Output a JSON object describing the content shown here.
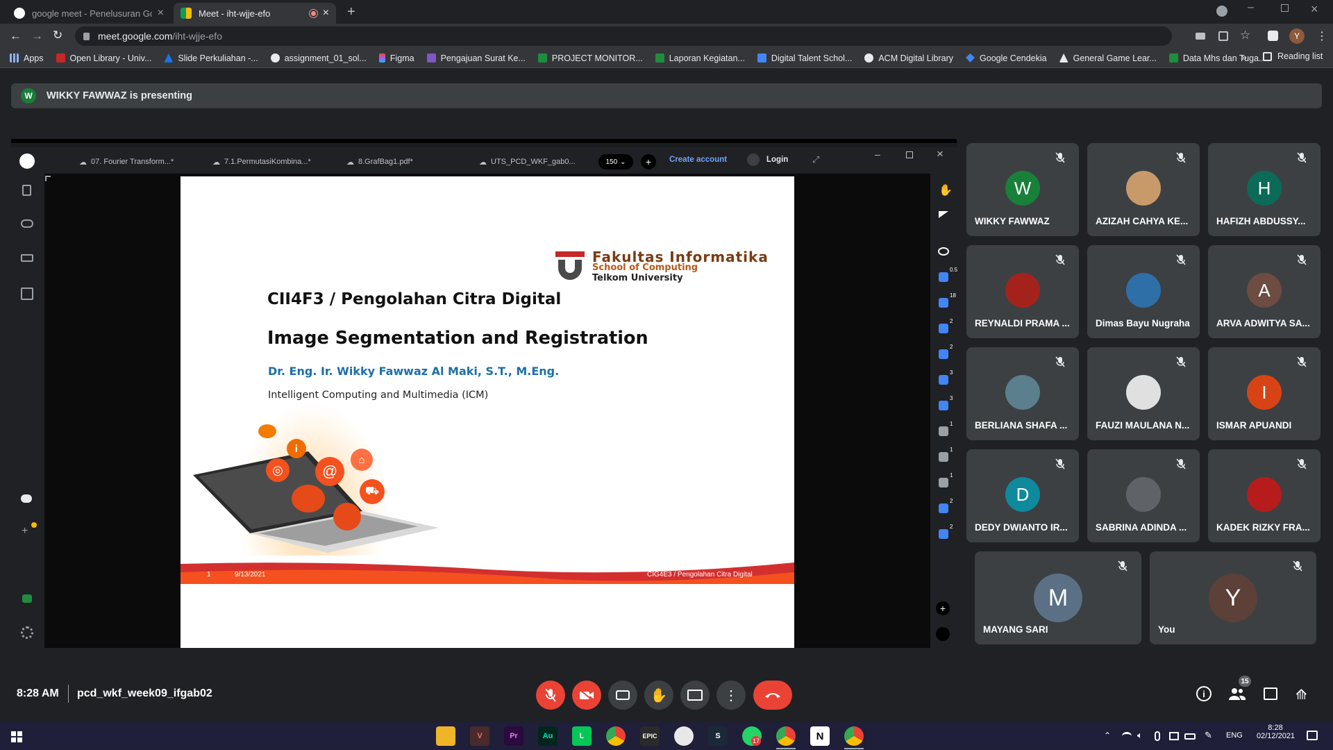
{
  "browser": {
    "tabs": [
      {
        "label": "google meet - Penelusuran Goog",
        "active": false
      },
      {
        "label": "Meet - iht-wjje-efo",
        "active": true
      }
    ],
    "url_host": "meet.google.com",
    "url_path": "/iht-wjje-efo",
    "profile_initial": "Y",
    "bookmarks": [
      "Apps",
      "Open Library - Univ...",
      "Slide Perkuliahan -...",
      "assignment_01_sol...",
      "Figma",
      "Pengajuan Surat Ke...",
      "PROJECT MONITOR...",
      "Laporan Kegiatan...",
      "Digital Talent Schol...",
      "ACM Digital Library",
      "Google Cendekia",
      "General Game Lear...",
      "Data Mhs dan Tuga..."
    ],
    "reading_list": "Reading list"
  },
  "meet": {
    "banner_initial": "W",
    "banner": "WIKKY FAWWAZ is presenting",
    "time": "8:28 AM",
    "meeting_code": "pcd_wkf_week09_ifgab02",
    "people_count": "15"
  },
  "pdf_viewer": {
    "tabs": [
      "07. Fourier Transform...*",
      "7.1.PermutasiKombina...*",
      "8.GrafBag1.pdf*",
      "UTS_PCD_WKF_gab0..."
    ],
    "zoom": "150",
    "create_account": "Create account",
    "login": "Login",
    "rail_badges": [
      "0.5",
      "18",
      "2",
      "2",
      "3",
      "3",
      "1",
      "1",
      "1",
      "2",
      "2"
    ]
  },
  "slide": {
    "logo_line1": "Fakultas Informatika",
    "logo_line2": "School of Computing",
    "logo_line3": "Telkom University",
    "course": "CII4F3 / Pengolahan Citra Digital",
    "title": "Image Segmentation and Registration",
    "author": "Dr. Eng.  Ir.  Wikky Fawwaz Al Maki, S.T., M.Eng.",
    "group": "Intelligent Computing and Multimedia (ICM)",
    "footer_page": "1",
    "footer_date": "9/13/2021",
    "footer_course": "CIG4E3 / Pengolahan Citra Digital"
  },
  "participants": [
    {
      "name": "WIKKY FAWWAZ",
      "initial": "W",
      "color": "#188038"
    },
    {
      "name": "AZIZAH CAHYA KE...",
      "initial": "",
      "color": "#c89a6a"
    },
    {
      "name": "HAFIZH ABDUSSY...",
      "initial": "H",
      "color": "#0b6b58"
    },
    {
      "name": "REYNALDI PRAMA ...",
      "initial": "",
      "color": "#a3231c"
    },
    {
      "name": "Dimas Bayu Nugraha",
      "initial": "",
      "color": "#2f6fa8"
    },
    {
      "name": "ARVA ADWITYA SA...",
      "initial": "A",
      "color": "#6d4c41"
    },
    {
      "name": "BERLIANA SHAFA ...",
      "initial": "",
      "color": "#5b7f8c"
    },
    {
      "name": "FAUZI MAULANA N...",
      "initial": "",
      "color": "#e0e0e0"
    },
    {
      "name": "ISMAR APUANDI",
      "initial": "I",
      "color": "#d84315"
    },
    {
      "name": "DEDY DWIANTO IR...",
      "initial": "D",
      "color": "#0f8a9d"
    },
    {
      "name": "SABRINA ADINDA ...",
      "initial": "",
      "color": "#5f6368"
    },
    {
      "name": "KADEK RIZKY FRA...",
      "initial": "",
      "color": "#b71c1c"
    },
    {
      "name": "MAYANG SARI",
      "initial": "M",
      "color": "#5b7085"
    },
    {
      "name": "You",
      "initial": "Y",
      "color": "#5d4037"
    }
  ],
  "taskbar": {
    "lang": "ENG",
    "time": "8:28",
    "date": "02/12/2021",
    "whatsapp_badge": "17"
  }
}
